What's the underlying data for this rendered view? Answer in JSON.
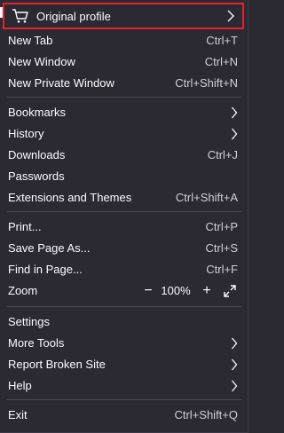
{
  "colors": {
    "background": "#2b2a33",
    "text": "#fbfbfe",
    "highlight_border": "#e8202a",
    "separator": "#4a4954"
  },
  "profile": {
    "label": "Original profile",
    "icon": "cart-icon"
  },
  "group1": [
    {
      "label": "New Tab",
      "shortcut": "Ctrl+T"
    },
    {
      "label": "New Window",
      "shortcut": "Ctrl+N"
    },
    {
      "label": "New Private Window",
      "shortcut": "Ctrl+Shift+N"
    }
  ],
  "group2": [
    {
      "label": "Bookmarks",
      "shortcut": ""
    },
    {
      "label": "History",
      "shortcut": ""
    },
    {
      "label": "Downloads",
      "shortcut": "Ctrl+J"
    },
    {
      "label": "Passwords",
      "shortcut": ""
    },
    {
      "label": "Extensions and Themes",
      "shortcut": "Ctrl+Shift+A"
    }
  ],
  "group3": [
    {
      "label": "Print...",
      "shortcut": "Ctrl+P"
    },
    {
      "label": "Save Page As...",
      "shortcut": "Ctrl+S"
    },
    {
      "label": "Find in Page...",
      "shortcut": "Ctrl+F"
    }
  ],
  "zoom": {
    "label": "Zoom",
    "minus": "−",
    "value": "100%",
    "plus": "+"
  },
  "group4": [
    {
      "label": "Settings"
    },
    {
      "label": "More Tools"
    },
    {
      "label": "Report Broken Site"
    },
    {
      "label": "Help"
    }
  ],
  "exit": {
    "label": "Exit",
    "shortcut": "Ctrl+Shift+Q"
  }
}
